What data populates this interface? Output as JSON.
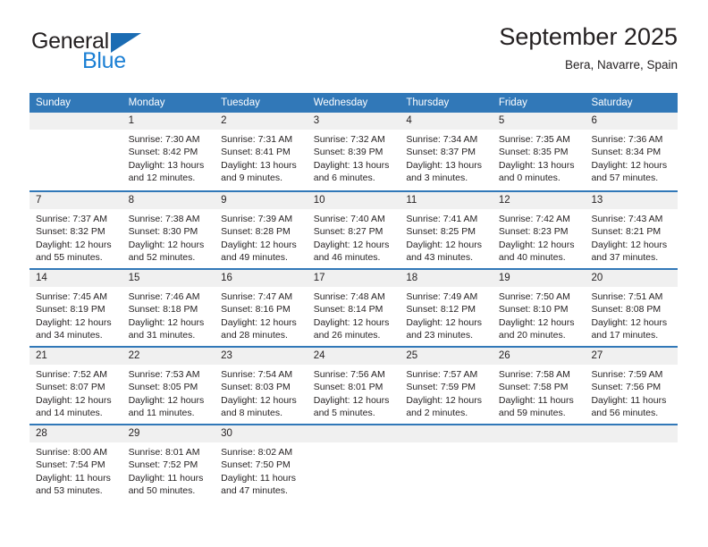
{
  "brand": {
    "name_part1": "General",
    "name_part2": "Blue",
    "triangle_icon": "blue-triangle-icon"
  },
  "header": {
    "title": "September 2025",
    "subtitle": "Bera, Navarre, Spain"
  },
  "colors": {
    "header_blue": "#3178b8",
    "brand_blue": "#1b7fd4",
    "daynum_band": "#f0f0f0",
    "text": "#231f20"
  },
  "weekday_headers": [
    "Sunday",
    "Monday",
    "Tuesday",
    "Wednesday",
    "Thursday",
    "Friday",
    "Saturday"
  ],
  "weeks": [
    [
      {
        "day": "",
        "lines": []
      },
      {
        "day": "1",
        "lines": [
          "Sunrise: 7:30 AM",
          "Sunset: 8:42 PM",
          "Daylight: 13 hours",
          "and 12 minutes."
        ]
      },
      {
        "day": "2",
        "lines": [
          "Sunrise: 7:31 AM",
          "Sunset: 8:41 PM",
          "Daylight: 13 hours",
          "and 9 minutes."
        ]
      },
      {
        "day": "3",
        "lines": [
          "Sunrise: 7:32 AM",
          "Sunset: 8:39 PM",
          "Daylight: 13 hours",
          "and 6 minutes."
        ]
      },
      {
        "day": "4",
        "lines": [
          "Sunrise: 7:34 AM",
          "Sunset: 8:37 PM",
          "Daylight: 13 hours",
          "and 3 minutes."
        ]
      },
      {
        "day": "5",
        "lines": [
          "Sunrise: 7:35 AM",
          "Sunset: 8:35 PM",
          "Daylight: 13 hours",
          "and 0 minutes."
        ]
      },
      {
        "day": "6",
        "lines": [
          "Sunrise: 7:36 AM",
          "Sunset: 8:34 PM",
          "Daylight: 12 hours",
          "and 57 minutes."
        ]
      }
    ],
    [
      {
        "day": "7",
        "lines": [
          "Sunrise: 7:37 AM",
          "Sunset: 8:32 PM",
          "Daylight: 12 hours",
          "and 55 minutes."
        ]
      },
      {
        "day": "8",
        "lines": [
          "Sunrise: 7:38 AM",
          "Sunset: 8:30 PM",
          "Daylight: 12 hours",
          "and 52 minutes."
        ]
      },
      {
        "day": "9",
        "lines": [
          "Sunrise: 7:39 AM",
          "Sunset: 8:28 PM",
          "Daylight: 12 hours",
          "and 49 minutes."
        ]
      },
      {
        "day": "10",
        "lines": [
          "Sunrise: 7:40 AM",
          "Sunset: 8:27 PM",
          "Daylight: 12 hours",
          "and 46 minutes."
        ]
      },
      {
        "day": "11",
        "lines": [
          "Sunrise: 7:41 AM",
          "Sunset: 8:25 PM",
          "Daylight: 12 hours",
          "and 43 minutes."
        ]
      },
      {
        "day": "12",
        "lines": [
          "Sunrise: 7:42 AM",
          "Sunset: 8:23 PM",
          "Daylight: 12 hours",
          "and 40 minutes."
        ]
      },
      {
        "day": "13",
        "lines": [
          "Sunrise: 7:43 AM",
          "Sunset: 8:21 PM",
          "Daylight: 12 hours",
          "and 37 minutes."
        ]
      }
    ],
    [
      {
        "day": "14",
        "lines": [
          "Sunrise: 7:45 AM",
          "Sunset: 8:19 PM",
          "Daylight: 12 hours",
          "and 34 minutes."
        ]
      },
      {
        "day": "15",
        "lines": [
          "Sunrise: 7:46 AM",
          "Sunset: 8:18 PM",
          "Daylight: 12 hours",
          "and 31 minutes."
        ]
      },
      {
        "day": "16",
        "lines": [
          "Sunrise: 7:47 AM",
          "Sunset: 8:16 PM",
          "Daylight: 12 hours",
          "and 28 minutes."
        ]
      },
      {
        "day": "17",
        "lines": [
          "Sunrise: 7:48 AM",
          "Sunset: 8:14 PM",
          "Daylight: 12 hours",
          "and 26 minutes."
        ]
      },
      {
        "day": "18",
        "lines": [
          "Sunrise: 7:49 AM",
          "Sunset: 8:12 PM",
          "Daylight: 12 hours",
          "and 23 minutes."
        ]
      },
      {
        "day": "19",
        "lines": [
          "Sunrise: 7:50 AM",
          "Sunset: 8:10 PM",
          "Daylight: 12 hours",
          "and 20 minutes."
        ]
      },
      {
        "day": "20",
        "lines": [
          "Sunrise: 7:51 AM",
          "Sunset: 8:08 PM",
          "Daylight: 12 hours",
          "and 17 minutes."
        ]
      }
    ],
    [
      {
        "day": "21",
        "lines": [
          "Sunrise: 7:52 AM",
          "Sunset: 8:07 PM",
          "Daylight: 12 hours",
          "and 14 minutes."
        ]
      },
      {
        "day": "22",
        "lines": [
          "Sunrise: 7:53 AM",
          "Sunset: 8:05 PM",
          "Daylight: 12 hours",
          "and 11 minutes."
        ]
      },
      {
        "day": "23",
        "lines": [
          "Sunrise: 7:54 AM",
          "Sunset: 8:03 PM",
          "Daylight: 12 hours",
          "and 8 minutes."
        ]
      },
      {
        "day": "24",
        "lines": [
          "Sunrise: 7:56 AM",
          "Sunset: 8:01 PM",
          "Daylight: 12 hours",
          "and 5 minutes."
        ]
      },
      {
        "day": "25",
        "lines": [
          "Sunrise: 7:57 AM",
          "Sunset: 7:59 PM",
          "Daylight: 12 hours",
          "and 2 minutes."
        ]
      },
      {
        "day": "26",
        "lines": [
          "Sunrise: 7:58 AM",
          "Sunset: 7:58 PM",
          "Daylight: 11 hours",
          "and 59 minutes."
        ]
      },
      {
        "day": "27",
        "lines": [
          "Sunrise: 7:59 AM",
          "Sunset: 7:56 PM",
          "Daylight: 11 hours",
          "and 56 minutes."
        ]
      }
    ],
    [
      {
        "day": "28",
        "lines": [
          "Sunrise: 8:00 AM",
          "Sunset: 7:54 PM",
          "Daylight: 11 hours",
          "and 53 minutes."
        ]
      },
      {
        "day": "29",
        "lines": [
          "Sunrise: 8:01 AM",
          "Sunset: 7:52 PM",
          "Daylight: 11 hours",
          "and 50 minutes."
        ]
      },
      {
        "day": "30",
        "lines": [
          "Sunrise: 8:02 AM",
          "Sunset: 7:50 PM",
          "Daylight: 11 hours",
          "and 47 minutes."
        ]
      },
      {
        "day": "",
        "lines": []
      },
      {
        "day": "",
        "lines": []
      },
      {
        "day": "",
        "lines": []
      },
      {
        "day": "",
        "lines": []
      }
    ]
  ]
}
